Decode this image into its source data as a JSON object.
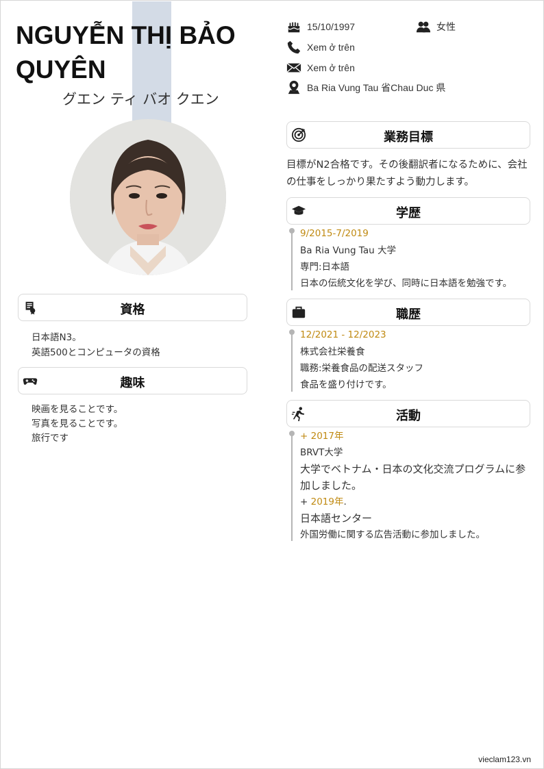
{
  "profile": {
    "name_line1": "NGUYỄN THỊ BẢO",
    "name_line2": "QUYÊN",
    "kana": "グエン ティ バオ クエン"
  },
  "info": {
    "birthdate": "15/10/1997",
    "gender": "女性",
    "phone": "Xem ở trên",
    "email": "Xem ở trên",
    "address": "Ba Ria Vung Tau 省Chau Duc 県"
  },
  "sections": {
    "qualifications": {
      "title": "資格",
      "items": [
        "日本語N3。",
        "英語500とコンピュータの資格"
      ]
    },
    "hobbies": {
      "title": "趣味",
      "items": [
        "映画を見ることです。",
        "写真を見ることです。",
        "旅行です"
      ]
    },
    "objective": {
      "title": "業務目標",
      "text": "目標がN2合格です。その後翻訳者になるために、会社の仕事をしっかり果たすよう動力します。"
    },
    "education": {
      "title": "学歴",
      "period": "9/2015-7/2019",
      "school": "Ba Ria Vung Tau 大学",
      "major": "専門:日本語",
      "desc": "日本の伝統文化を学び、同時に日本語を勉強です。"
    },
    "work": {
      "title": "職歴",
      "period": "12/2021 - 12/2023",
      "company": "株式会社栄養食",
      "position": "職務:栄養食品の配送スタッフ",
      "desc": "食品を盛り付けです。"
    },
    "activities": {
      "title": "活動",
      "year1": "+ 2017年",
      "org1": "BRVT大学",
      "desc1_line1": "大学でベトナム・日本の文化交流プログラムに参",
      "desc1_line2": "加しました。",
      "year2_prefix": "+ ",
      "year2": "2019年",
      "year2_suffix": ".",
      "org2": "日本語センター",
      "desc2": "外国労働に関する広告活動に参加しました。"
    }
  },
  "footer": "vieclam123.vn",
  "colors": {
    "accent_gold": "#c08a12",
    "stripe": "#d3dbe6"
  }
}
